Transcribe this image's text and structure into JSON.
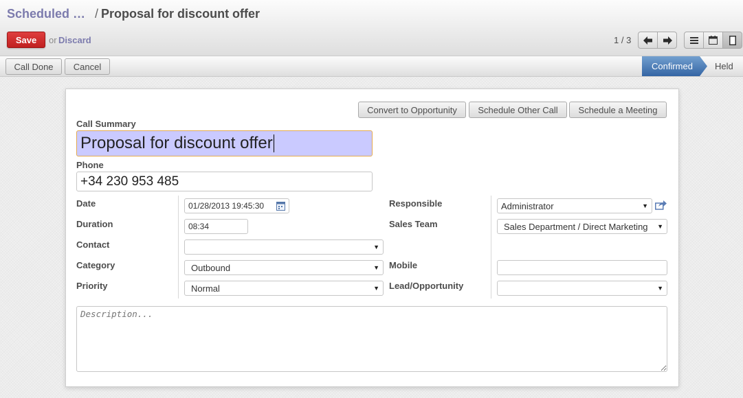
{
  "breadcrumb": {
    "parent": "Scheduled …",
    "separator": "/",
    "current": "Proposal for discount offer"
  },
  "actions": {
    "save_label": "Save",
    "or_text": "or",
    "discard_label": "Discard"
  },
  "pager": {
    "text": "1 / 3",
    "prev_icon": "arrow-left-icon",
    "next_icon": "arrow-right-icon"
  },
  "view_switcher": {
    "icons": [
      "list-view-icon",
      "calendar-view-icon",
      "form-view-icon"
    ],
    "active": "form-view-icon"
  },
  "statusbar": {
    "buttons": [
      "Call Done",
      "Cancel"
    ],
    "stages": [
      {
        "label": "Confirmed",
        "active": true
      },
      {
        "label": "Held",
        "active": false
      }
    ],
    "accent_color": "#3465a4"
  },
  "sheet": {
    "top_buttons": [
      "Convert to Opportunity",
      "Schedule Other Call",
      "Schedule a Meeting"
    ],
    "call_summary": {
      "label": "Call Summary",
      "value": "Proposal for discount offer",
      "focus_bg": "#cacaff",
      "focus_border": "#e3a94e"
    },
    "phone": {
      "label": "Phone",
      "value": "+34 230 953 485"
    },
    "date": {
      "label": "Date",
      "value": "01/28/2013 19:45:30",
      "icon": "calendar-picker-icon"
    },
    "duration": {
      "label": "Duration",
      "value": "08:34"
    },
    "contact": {
      "label": "Contact",
      "value": ""
    },
    "category": {
      "label": "Category",
      "value": "Outbound"
    },
    "priority": {
      "label": "Priority",
      "value": "Normal"
    },
    "responsible": {
      "label": "Responsible",
      "value": "Administrator",
      "icon": "external-link-icon"
    },
    "sales_team": {
      "label": "Sales Team",
      "value": "Sales Department / Direct Marketing"
    },
    "mobile": {
      "label": "Mobile",
      "value": ""
    },
    "lead_opportunity": {
      "label": "Lead/Opportunity",
      "value": ""
    },
    "description": {
      "placeholder": "Description..."
    }
  }
}
